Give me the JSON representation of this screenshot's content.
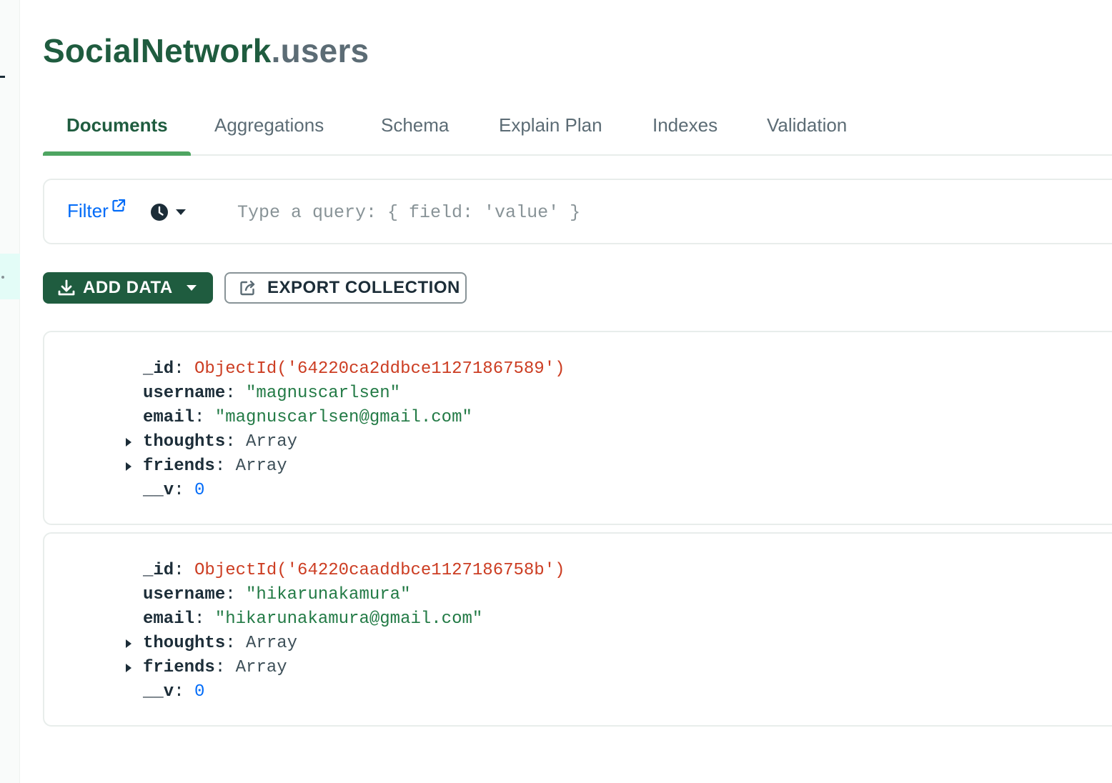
{
  "header": {
    "database": "SocialNetwork",
    "collection": ".users"
  },
  "tabs": [
    {
      "label": "Documents",
      "active": true
    },
    {
      "label": "Aggregations",
      "active": false
    },
    {
      "label": "Schema",
      "active": false
    },
    {
      "label": "Explain Plan",
      "active": false
    },
    {
      "label": "Indexes",
      "active": false
    },
    {
      "label": "Validation",
      "active": false
    }
  ],
  "filter": {
    "label": "Filter",
    "placeholder": "Type a query: { field: 'value' }",
    "link_icon": "external-link-icon",
    "history_icon": "clock-icon"
  },
  "toolbar": {
    "add_data_label": "ADD DATA",
    "export_label": "EXPORT COLLECTION"
  },
  "documents": [
    {
      "id_key": "_id",
      "id_value": "ObjectId('64220ca2ddbce11271867589')",
      "username_key": "username",
      "username_value": "\"magnuscarlsen\"",
      "email_key": "email",
      "email_value": "\"magnuscarlsen@gmail.com\"",
      "thoughts_key": "thoughts",
      "thoughts_value": "Array",
      "friends_key": "friends",
      "friends_value": "Array",
      "v_key": "__v",
      "v_value": "0"
    },
    {
      "id_key": "_id",
      "id_value": "ObjectId('64220caaddbce1127186758b')",
      "username_key": "username",
      "username_value": "\"hikarunakamura\"",
      "email_key": "email",
      "email_value": "\"hikarunakamura@gmail.com\"",
      "thoughts_key": "thoughts",
      "thoughts_value": "Array",
      "friends_key": "friends",
      "friends_value": "Array",
      "v_key": "__v",
      "v_value": "0"
    }
  ],
  "colors": {
    "brand_green": "#1f5c3f",
    "tab_underline": "#4ea561",
    "link_blue": "#016bf8",
    "objectid_red": "#cc3d22",
    "string_green": "#227a45"
  }
}
